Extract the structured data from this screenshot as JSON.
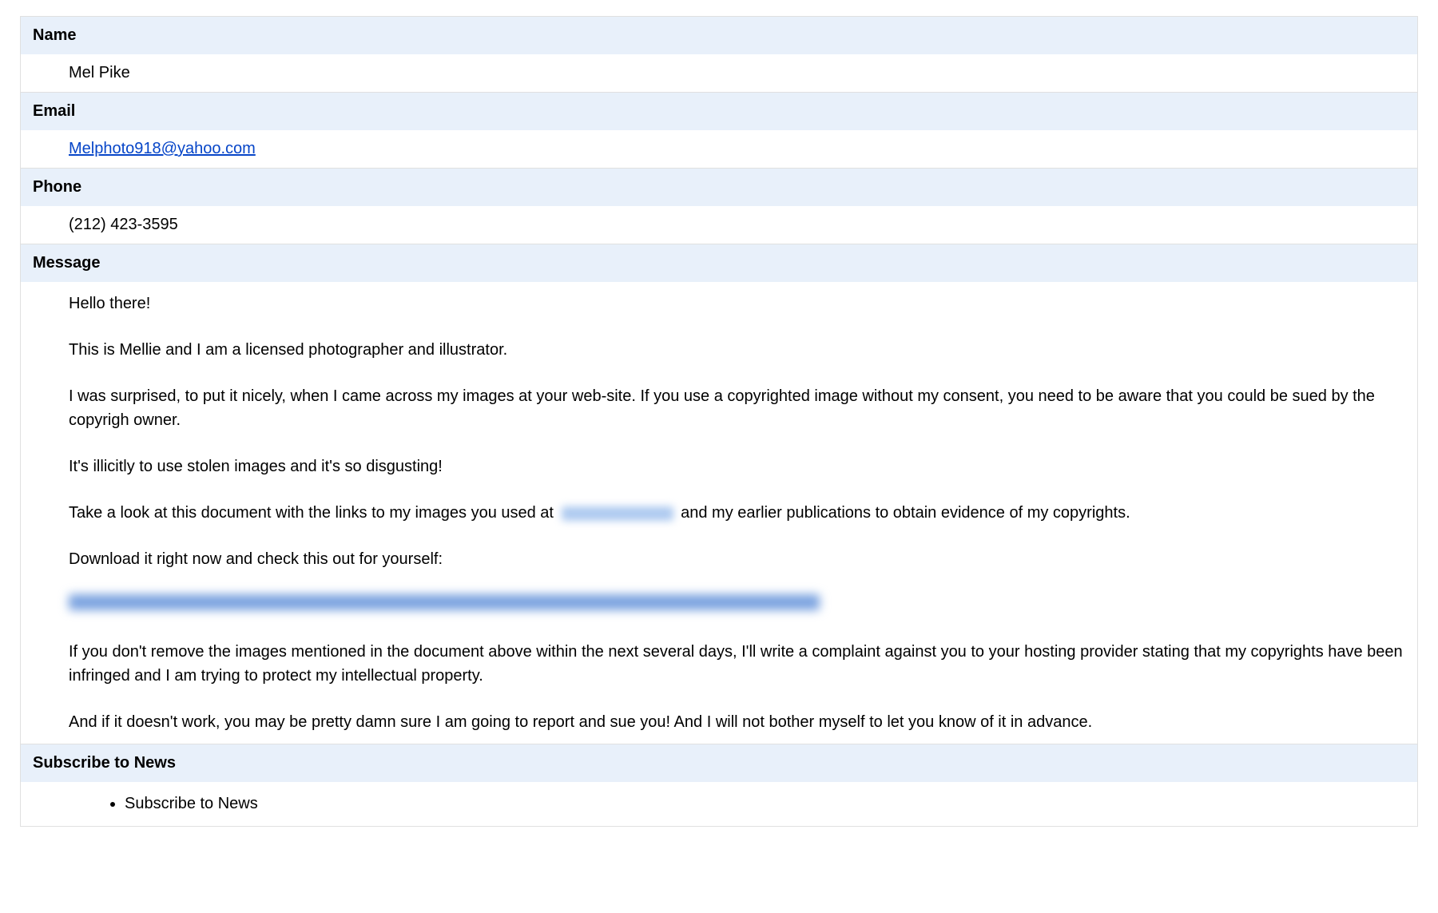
{
  "fields": {
    "name": {
      "label": "Name",
      "value": "Mel Pike"
    },
    "email": {
      "label": "Email",
      "value": "Melphoto918@yahoo.com"
    },
    "phone": {
      "label": "Phone",
      "value": "(212) 423-3595"
    },
    "message": {
      "label": "Message",
      "paragraphs": {
        "p1": "Hello there!",
        "p2": "This is Mellie and I am a licensed photographer and illustrator.",
        "p3": "I was surprised, to put it nicely, when I came across my images at your web-site. If you use a copyrighted image without my consent, you need to be aware that you could be sued by the copyrigh owner.",
        "p4": "It's illicitly to use stolen images and it's so disgusting!",
        "p5_before": "Take a look at this document with the links to my images you used at",
        "p5_after": "and my earlier publications to obtain evidence of my copyrights.",
        "p6": "Download it right now and check this out for yourself:",
        "p8": "If you don't remove the images mentioned in the document above within the next several days, I'll write a complaint against you to your hosting provider stating that my copyrights have been infringed and I am trying to protect my intellectual property.",
        "p9": "And if it doesn't work, you may be pretty damn sure I am going to report and sue you! And I will not bother myself to let you know of it in advance."
      }
    },
    "subscribe": {
      "label": "Subscribe to News",
      "item": "Subscribe to News"
    }
  }
}
